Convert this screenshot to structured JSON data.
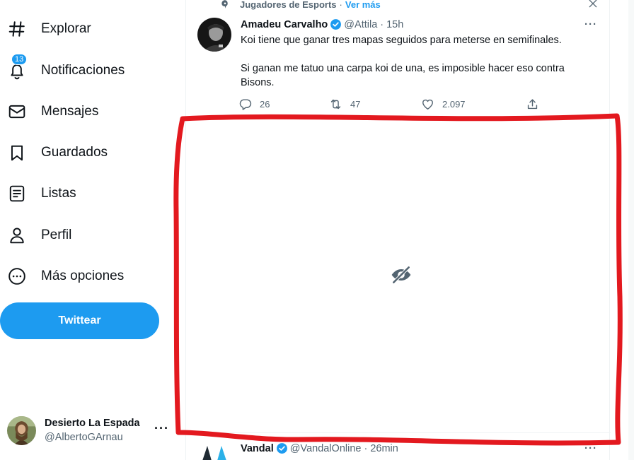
{
  "sidebar": {
    "items": [
      {
        "label": "Explorar",
        "icon": "hashtag-icon"
      },
      {
        "label": "Notificaciones",
        "icon": "bell-icon",
        "badge": "13"
      },
      {
        "label": "Mensajes",
        "icon": "envelope-icon"
      },
      {
        "label": "Guardados",
        "icon": "bookmark-icon"
      },
      {
        "label": "Listas",
        "icon": "list-icon"
      },
      {
        "label": "Perfil",
        "icon": "person-icon"
      },
      {
        "label": "Más opciones",
        "icon": "more-circle-icon"
      }
    ],
    "tweet_button": "Twittear",
    "account": {
      "name": "Desierto La Espada",
      "handle": "@AlbertoGArnau",
      "more": "···"
    }
  },
  "timeline": {
    "context": {
      "topic": "Jugadores de Esports",
      "separator": "·",
      "link": "Ver más"
    },
    "tweet1": {
      "author": "Amadeu Carvalho",
      "handle": "@Attila",
      "separator": "·",
      "time": "15h",
      "more": "···",
      "text_line1": "Koi tiene que ganar tres mapas seguidos para meterse en semifinales.",
      "text_line2": "Si ganan me tatuo una carpa koi de una, es imposible hacer eso contra Bisons.",
      "replies": "26",
      "retweets": "47",
      "likes": "2.097"
    },
    "tweet2": {
      "author": "Vandal",
      "handle": "@VandalOnline",
      "separator": "·",
      "time": "26min",
      "more": "···"
    }
  },
  "colors": {
    "accent": "#1d9bf0",
    "text_primary": "#0f1419",
    "text_secondary": "#536471",
    "annotation": "#e3191f"
  }
}
